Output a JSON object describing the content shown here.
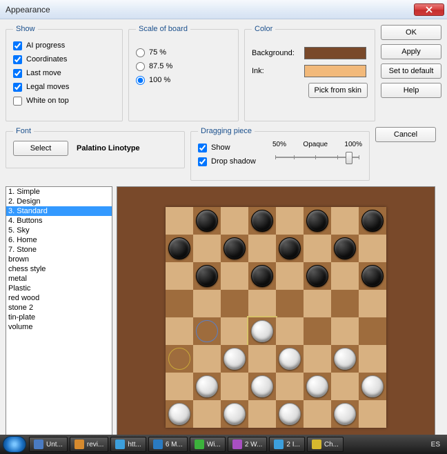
{
  "window": {
    "title": "Appearance"
  },
  "groups": {
    "show": "Show",
    "scale": "Scale of board",
    "color": "Color",
    "font": "Font",
    "drag": "Dragging piece"
  },
  "show_options": {
    "ai_progress": "AI progress",
    "coordinates": "Coordinates",
    "last_move": "Last move",
    "legal_moves": "Legal moves",
    "white_on_top": "White on top"
  },
  "show_checked": {
    "ai_progress": true,
    "coordinates": true,
    "last_move": true,
    "legal_moves": true,
    "white_on_top": false
  },
  "scale_options": {
    "p75": "75 %",
    "p875": "87.5 %",
    "p100": "100 %"
  },
  "scale_selected": "p100",
  "color": {
    "background_label": "Background:",
    "ink_label": "Ink:",
    "pick_button": "Pick from skin",
    "background_value": "#79492a",
    "ink_value": "#f2b97a"
  },
  "buttons": {
    "ok": "OK",
    "apply": "Apply",
    "set_default": "Set to default",
    "help": "Help",
    "cancel": "Cancel",
    "select": "Select"
  },
  "font": {
    "name": "Palatino Linotype"
  },
  "drag": {
    "show": "Show",
    "drop_shadow": "Drop shadow",
    "show_checked": true,
    "drop_shadow_checked": true,
    "scale_50": "50%",
    "scale_label": "Opaque",
    "scale_100": "100%",
    "value_pct": 92
  },
  "skins": [
    "1. Simple",
    "2. Design",
    "3. Standard",
    "4. Buttons",
    "5. Sky",
    "6. Home",
    "7. Stone",
    "brown",
    "chess style",
    "metal",
    "Plastic",
    "red wood",
    "stone 2",
    "tin-plate",
    "volume"
  ],
  "selected_skin_index": 2,
  "board": {
    "rows": [
      [
        ".",
        "b",
        ".",
        "b",
        ".",
        "b",
        ".",
        "b"
      ],
      [
        "b",
        ".",
        "b",
        ".",
        "b",
        ".",
        "b",
        "."
      ],
      [
        ".",
        "b",
        ".",
        "b",
        ".",
        "b",
        ".",
        "b"
      ],
      [
        ".",
        ".",
        ".",
        ".",
        ".",
        ".",
        ".",
        "."
      ],
      [
        ".",
        "B",
        ".",
        "W",
        ".",
        ".",
        ".",
        "."
      ],
      [
        "G",
        ".",
        "w",
        ".",
        "w",
        ".",
        "w",
        "."
      ],
      [
        ".",
        "w",
        ".",
        "w",
        ".",
        "w",
        ".",
        "w"
      ],
      [
        "w",
        ".",
        "w",
        ".",
        "w",
        ".",
        "w",
        "."
      ]
    ],
    "highlight_cell": [
      4,
      3
    ]
  },
  "taskbar": {
    "items": [
      "Unt...",
      "revi...",
      "htt...",
      "6 M...",
      "Wi...",
      "2 W...",
      "2 I...",
      "Ch..."
    ],
    "lang": "ES"
  }
}
